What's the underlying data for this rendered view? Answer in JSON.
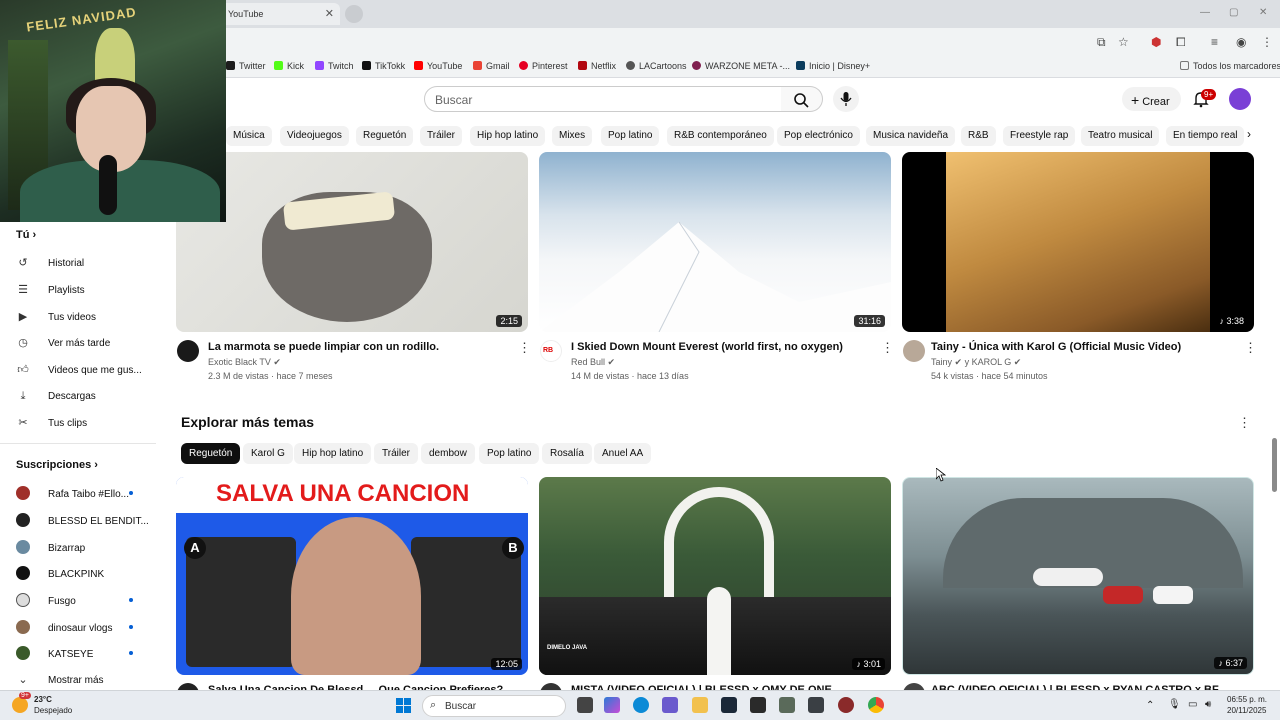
{
  "browser": {
    "tab_title": "YouTube",
    "bookmarks": [
      "Twitter",
      "Kick",
      "Twitch",
      "TikTokk",
      "YouTube",
      "Gmail",
      "Pinterest",
      "Netflix",
      "LACartoons",
      "WARZONE META -...",
      "Inicio | Disney+"
    ],
    "all_bookmarks": "Todos los marcadores"
  },
  "header": {
    "search_placeholder": "Buscar",
    "create_label": "Crear",
    "notifications_badge": "9+"
  },
  "chips": [
    "Música",
    "Videojuegos",
    "Reguetón",
    "Tráiler",
    "Hip hop latino",
    "Mixes",
    "Pop latino",
    "R&B contemporáneo",
    "Pop electrónico",
    "Musica navideña",
    "R&B",
    "Freestyle rap",
    "Teatro musical",
    "En tiempo real"
  ],
  "webcam": {
    "sign": "FELIZ NAVIDAD"
  },
  "sidebar": {
    "you_label": "Tú",
    "items": [
      "Historial",
      "Playlists",
      "Tus videos",
      "Ver más tarde",
      "Videos que me gus...",
      "Descargas",
      "Tus clips"
    ],
    "subs_label": "Suscripciones",
    "subs": [
      "Rafa Taibo #Ello...",
      "BLESSD EL BENDIT...",
      "Bizarrap",
      "BLACKPINK",
      "Fusgo",
      "dinosaur vlogs",
      "KATSEYE"
    ],
    "show_more": "Mostrar más"
  },
  "videos": [
    {
      "title": "La marmota se puede limpiar con un rodillo.",
      "channel": "Exotic Black TV",
      "meta": "2.3 M de vistas · hace 7 meses",
      "duration": "2:15"
    },
    {
      "title": "I Skied Down Mount Everest (world first, no oxygen)",
      "channel": "Red Bull",
      "meta": "14 M de vistas · hace 13 días",
      "duration": "31:16"
    },
    {
      "title": "Tainy - Única with Karol G (Official Music Video)",
      "channel": "Tainy",
      "channel2": "y KAROL G",
      "meta": "54 k vistas · hace 54 minutos",
      "duration": "3:38"
    }
  ],
  "explore": {
    "title": "Explorar más temas",
    "chips": [
      "Reguetón",
      "Karol G",
      "Hip hop latino",
      "Tráiler",
      "dembow",
      "Pop latino",
      "Rosalía",
      "Anuel AA"
    ],
    "videos": [
      {
        "thumb_text": "SALVA UNA CANCION",
        "label_a": "A",
        "label_b": "B",
        "duration": "12:05",
        "title": "Salva Una Cancion De Blessd ... Que Cancion Prefieres?"
      },
      {
        "duration": "3:01",
        "logo": "DIMELO JAVA",
        "title": "MISTA (VIDEO OFICIAL) | BLESSD x OMY DE ONE"
      },
      {
        "duration": "6:37",
        "title": "ABC (VIDEO OFICIAL) | BLESSD x RYAN CASTRO x BF"
      }
    ]
  },
  "taskbar": {
    "weather_temp": "23°C",
    "weather_desc": "Despejado",
    "weather_badge": "9+",
    "search": "Buscar",
    "time": "06:55 p. m.",
    "date": "20/11/2025"
  }
}
